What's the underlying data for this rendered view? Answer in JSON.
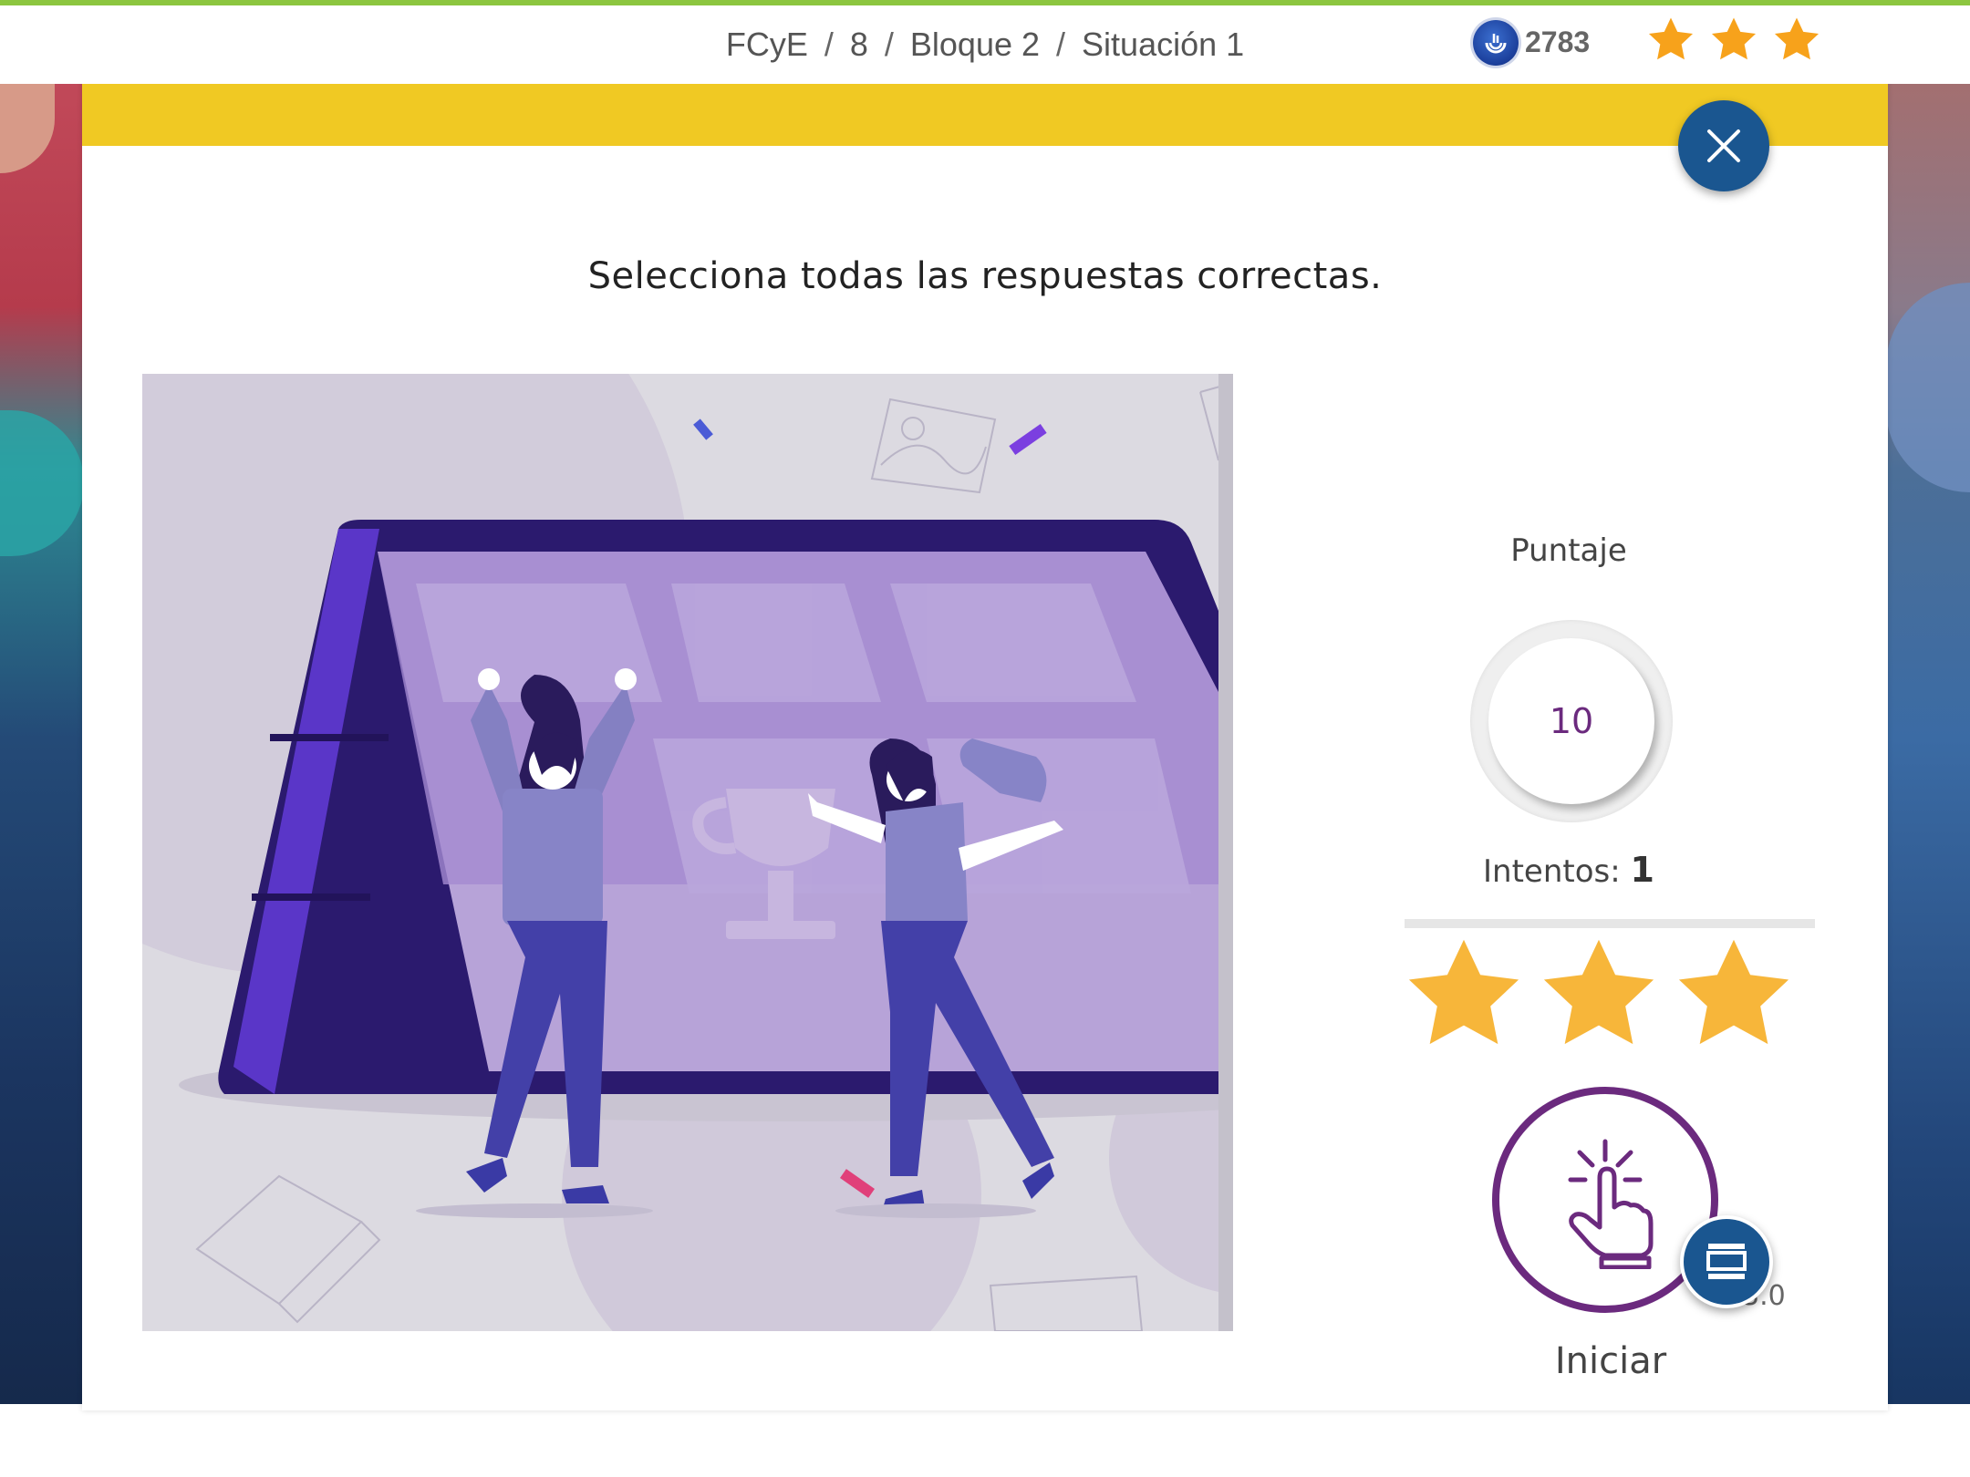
{
  "breadcrumb": {
    "items": [
      "FCyE",
      "8",
      "Bloque 2",
      "Situación 1"
    ],
    "separator": "/"
  },
  "header": {
    "points": "2783",
    "coin_icon": "coin-icon",
    "stars_earned": 3,
    "stars_total": 3,
    "star_color": "#f7a21b"
  },
  "modal": {
    "header_color": "#f0c923",
    "instruction": "Selecciona todas las respuestas correctas.",
    "close_icon": "close-icon"
  },
  "score": {
    "label": "Puntaje",
    "value": "10",
    "attempts_label": "Intentos:",
    "attempts_value": "1",
    "stars_earned": 3,
    "stars_total": 3,
    "star_color": "#f7b63a"
  },
  "start": {
    "label": "Iniciar",
    "icon": "hand-tap-icon",
    "ring_color": "#6b2a7e"
  },
  "footer": {
    "version": "3.0",
    "fab_icon": "layout-icon"
  },
  "colors": {
    "accent_blue": "#1a5690",
    "top_accent": "#8cc63f",
    "purple": "#6b2a7e"
  }
}
